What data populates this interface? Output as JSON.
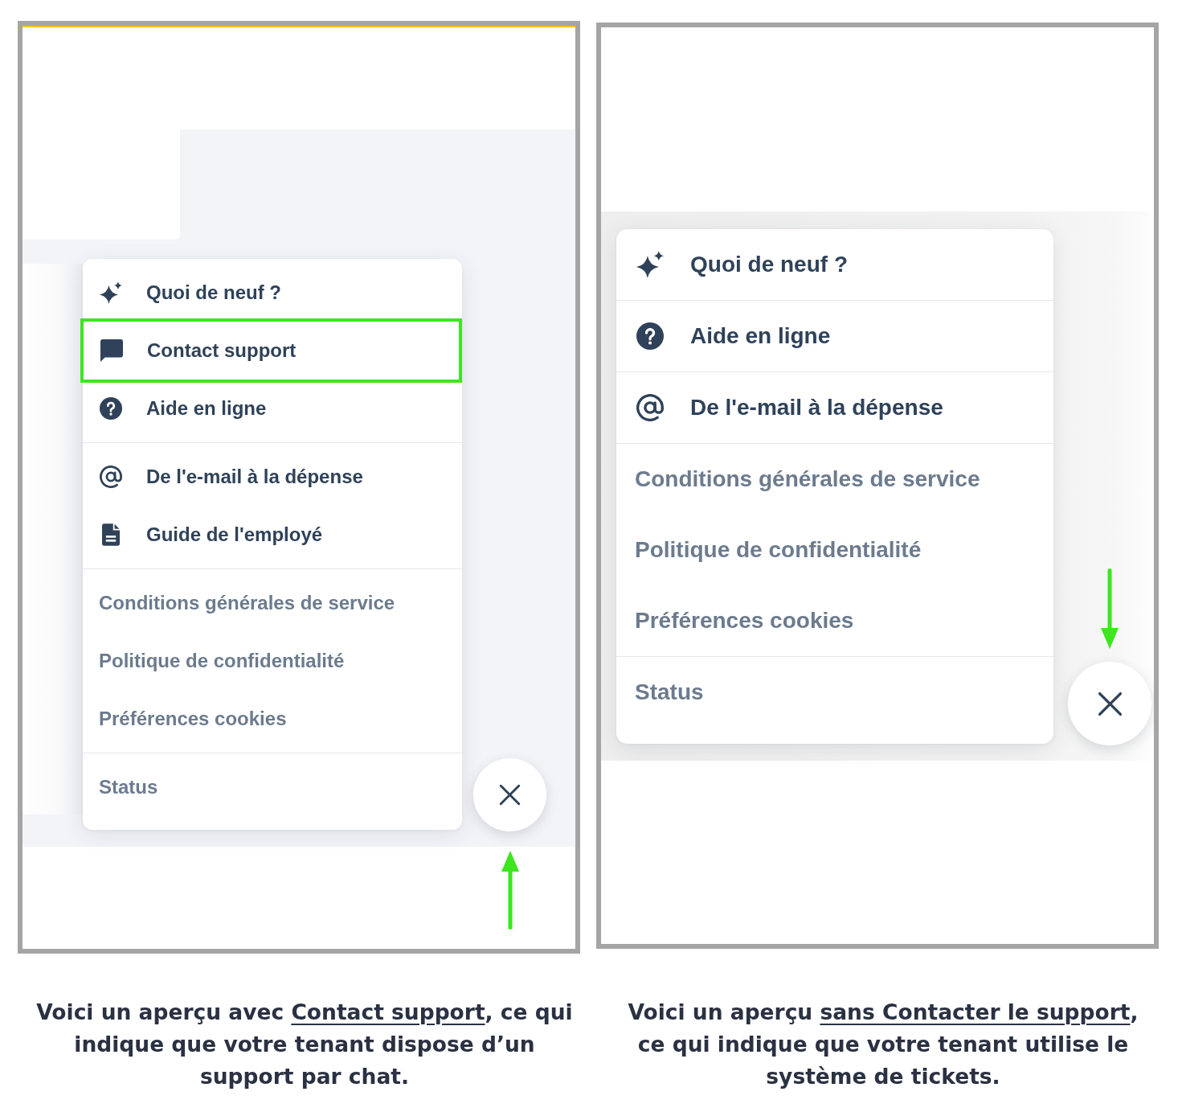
{
  "panels": [
    {
      "kind": "app-view",
      "menu": {
        "groups": [
          {
            "items": [
              {
                "kind": "news",
                "label": "Quoi de neuf ?",
                "highlighted": false
              },
              {
                "kind": "chat",
                "label": "Contact support",
                "highlighted": true
              },
              {
                "kind": "help",
                "label": "Aide en ligne",
                "highlighted": false
              }
            ]
          },
          {
            "items": [
              {
                "kind": "email",
                "label": "De l'e-mail à la dépense",
                "highlighted": false
              },
              {
                "kind": "guide",
                "label": "Guide de l'employé",
                "highlighted": false
              }
            ]
          },
          {
            "items": [
              {
                "kind": "link",
                "label": "Conditions générales de service",
                "highlighted": false
              },
              {
                "kind": "link",
                "label": "Politique de confidentialité",
                "highlighted": false
              },
              {
                "kind": "link",
                "label": "Préférences cookies",
                "highlighted": false
              }
            ]
          },
          {
            "items": [
              {
                "kind": "link",
                "label": "Status",
                "highlighted": false
              }
            ]
          }
        ]
      },
      "annotation_arrow": {
        "pointing_up": true
      },
      "caption": {
        "before": "Voici un aperçu avec ",
        "link": "Contact support",
        "after": ", ce qui\nindique que votre tenant dispose d’un\nsupport par chat."
      }
    },
    {
      "kind": "overlay-view",
      "menu": {
        "groups": [
          {
            "items": [
              {
                "kind": "news",
                "label": "Quoi de neuf ?",
                "highlighted": false
              }
            ]
          },
          {
            "items": [
              {
                "kind": "help",
                "label": "Aide en ligne",
                "highlighted": false
              }
            ]
          },
          {
            "items": [
              {
                "kind": "email",
                "label": "De l'e-mail à la dépense",
                "highlighted": false
              }
            ]
          },
          {
            "items": [
              {
                "kind": "link",
                "label": "Conditions générales de service",
                "highlighted": false
              },
              {
                "kind": "link",
                "label": "Politique de confidentialité",
                "highlighted": false
              },
              {
                "kind": "link",
                "label": "Préférences cookies",
                "highlighted": false
              }
            ]
          },
          {
            "items": [
              {
                "kind": "link",
                "label": "Status",
                "highlighted": false
              }
            ]
          }
        ]
      },
      "annotation_arrow": {
        "pointing_up": false
      },
      "caption": {
        "before": "Voici un aperçu ",
        "link": "sans Contacter le support",
        "after": ",\nce qui indique que votre tenant utilise le\nsystème de tickets."
      }
    }
  ]
}
